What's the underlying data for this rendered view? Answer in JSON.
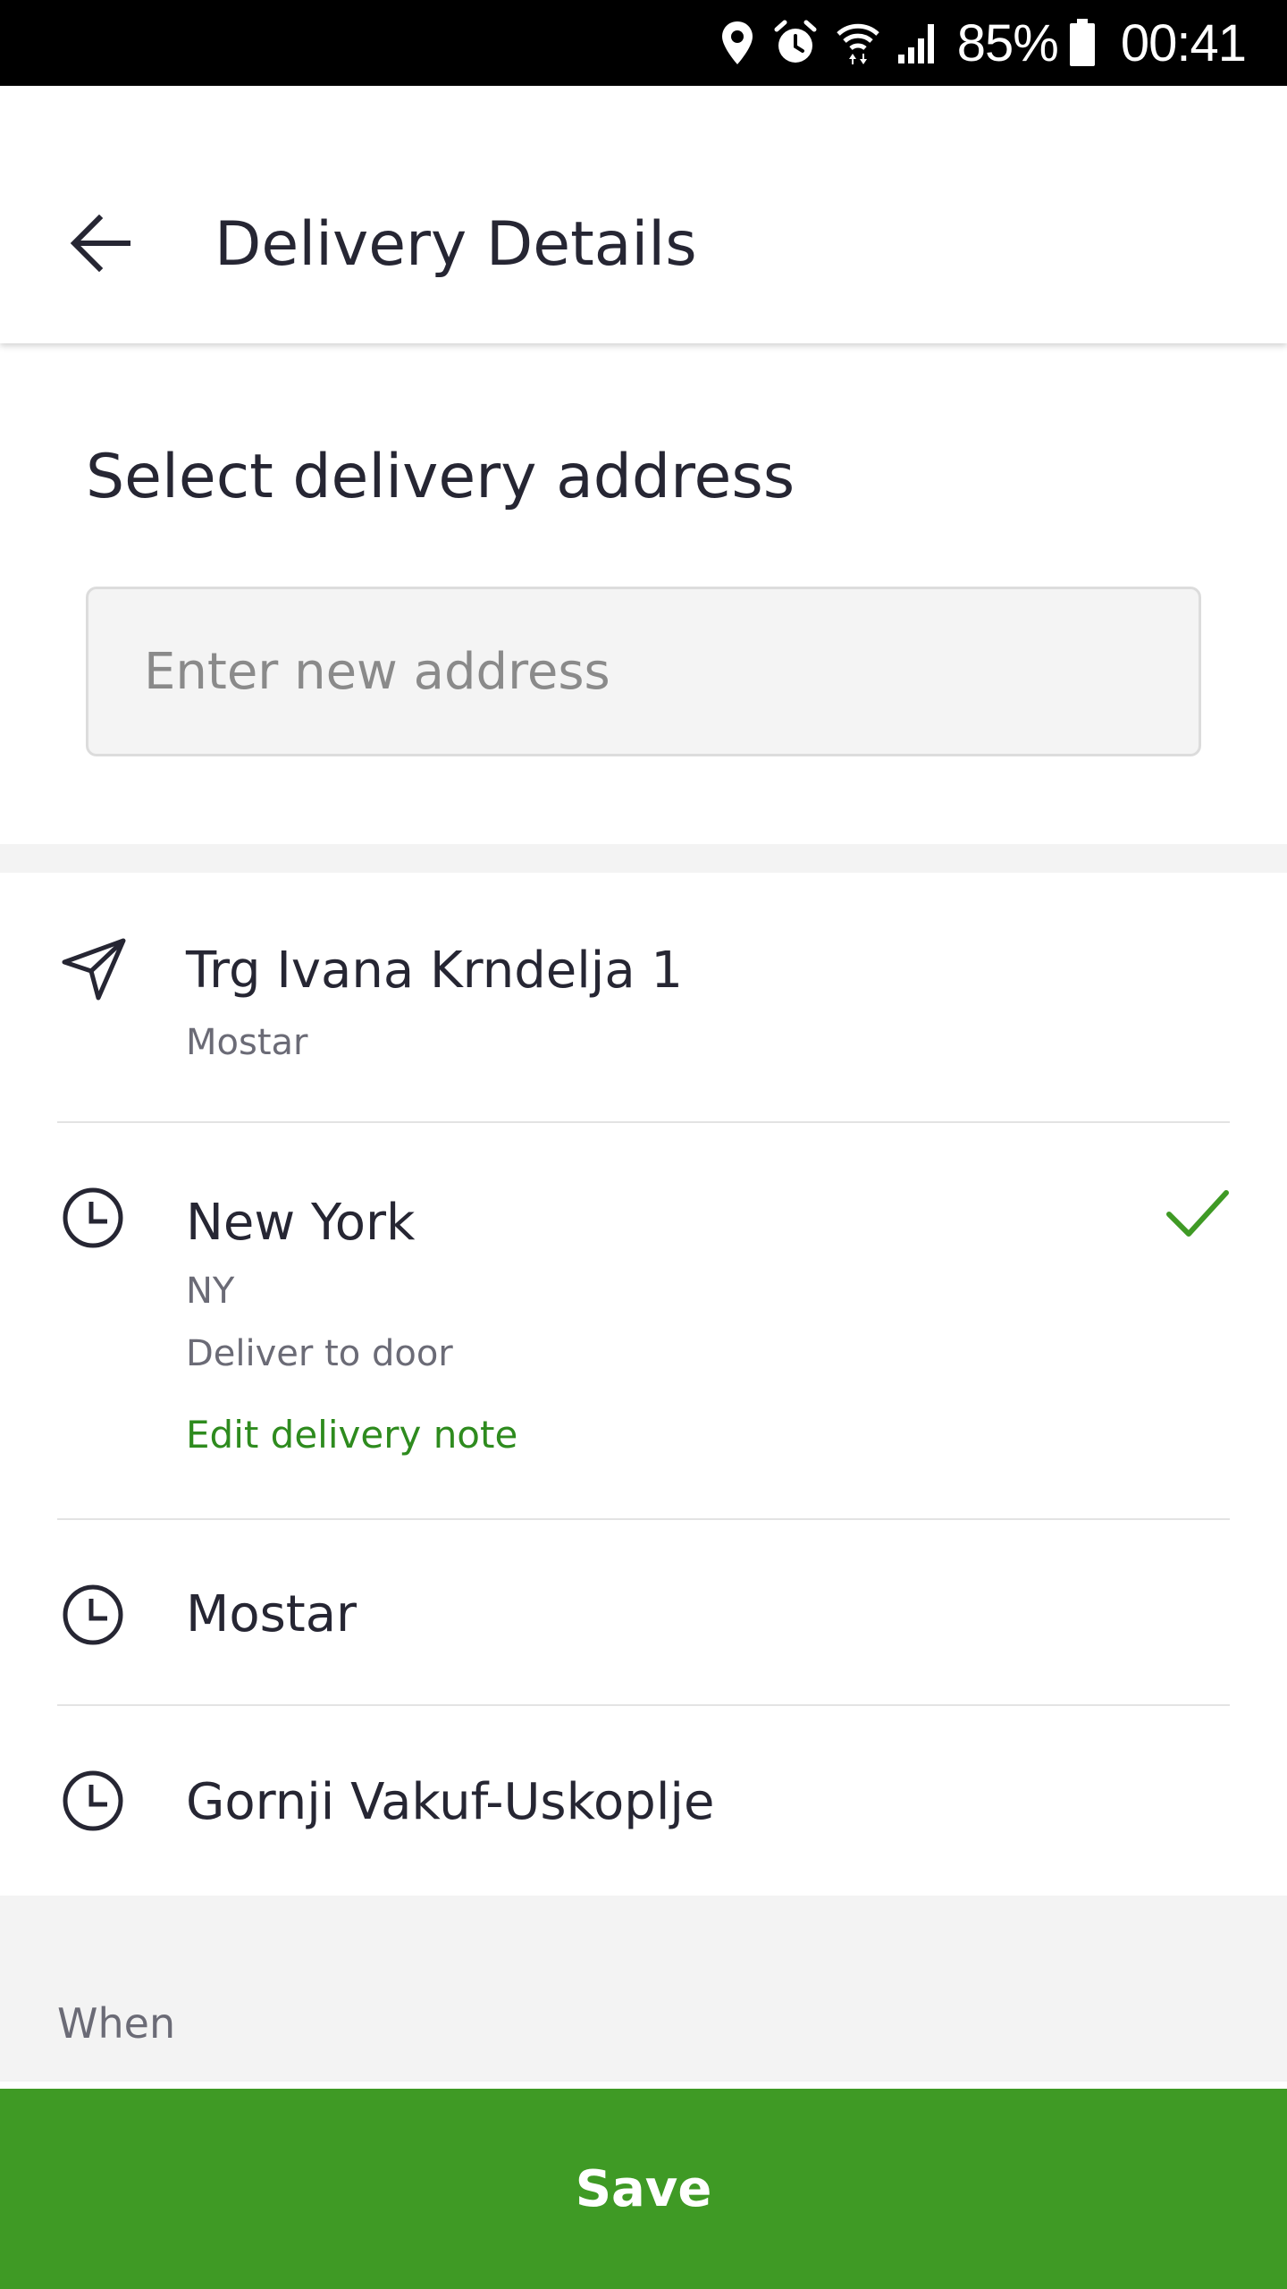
{
  "status_bar": {
    "battery": "85%",
    "time": "00:41",
    "icons": [
      "location-icon",
      "alarm-icon",
      "wifi-icon",
      "signal-icon",
      "battery-icon"
    ]
  },
  "app_bar": {
    "title": "Delivery Details",
    "back_icon": "arrow-left-icon"
  },
  "address_section": {
    "title": "Select delivery address",
    "input": {
      "placeholder": "Enter new address",
      "value": ""
    }
  },
  "addresses": [
    {
      "icon": "navigation-arrow-icon",
      "title": "Trg Ivana Krndelja 1",
      "subtitle": "Mostar",
      "selected": false
    },
    {
      "icon": "clock-icon",
      "title": "New York",
      "subtitle": "NY",
      "note": "Deliver to door",
      "action": "Edit delivery note",
      "selected": true
    },
    {
      "icon": "clock-icon",
      "title": "Mostar",
      "selected": false
    },
    {
      "icon": "clock-icon",
      "title": "Gornji Vakuf-Uskoplje",
      "selected": false
    }
  ],
  "when_section": {
    "label": "When"
  },
  "save_button": {
    "label": "Save"
  },
  "colors": {
    "accent_green": "#3f9a25",
    "link_green": "#2e8b1e",
    "text_primary": "#262633",
    "text_secondary": "#6b6b76"
  }
}
